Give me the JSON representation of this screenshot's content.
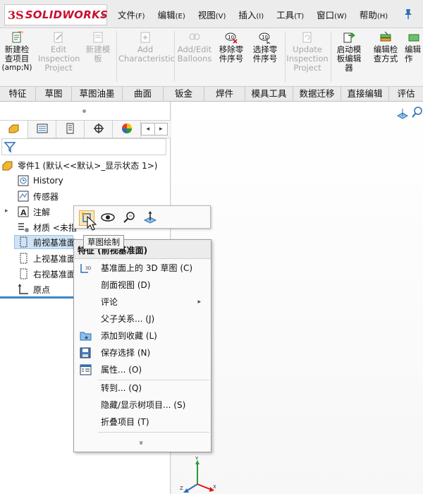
{
  "app": {
    "logo_ds": "3S",
    "logo_word": "SOLIDWORKS"
  },
  "menu": [
    {
      "label": "文件",
      "key": "(F)"
    },
    {
      "label": "编辑",
      "key": "(E)"
    },
    {
      "label": "视图",
      "key": "(V)"
    },
    {
      "label": "插入",
      "key": "(I)"
    },
    {
      "label": "工具",
      "key": "(T)"
    },
    {
      "label": "窗口",
      "key": "(W)"
    },
    {
      "label": "帮助",
      "key": "(H)"
    }
  ],
  "ribbon": {
    "new_inspection": {
      "line1": "新建检",
      "line2": "查项目",
      "line3": "(amp;N)"
    },
    "edit_inspection": {
      "line1": "Edit",
      "line2": "Inspection",
      "line3": "Project"
    },
    "new_template": {
      "line1": "新建模",
      "line2": "板"
    },
    "add_characteristic": {
      "line1": "Add",
      "line2": "Characteristic"
    },
    "add_edit_balloons": {
      "line1": "Add/Edit",
      "line2": "Balloons"
    },
    "remove_seq": {
      "line1": "移除零",
      "line2": "件序号"
    },
    "select_seq": {
      "line1": "选择零",
      "line2": "件序号"
    },
    "update_inspection": {
      "line1": "Update",
      "line2": "Inspection",
      "line3": "Project"
    },
    "launch_template_editor": {
      "line1": "启动模",
      "line2": "板编辑",
      "line3": "器"
    },
    "edit_inspection_method": {
      "line1": "编辑检",
      "line2": "查方式"
    },
    "edit_more": {
      "line1": "编辑",
      "line2": "作"
    }
  },
  "tabs": [
    "特征",
    "草图",
    "草图油墨",
    "曲面",
    "钣金",
    "焊件",
    "模具工具",
    "数据迁移",
    "直接编辑",
    "评估"
  ],
  "tree": {
    "root": "零件1 (默认<<默认>_显示状态 1>)",
    "history": "History",
    "sensors": "传感器",
    "annotations": "注解",
    "material": "材质 <未指",
    "front_plane": "前视基准面",
    "top_plane": "上视基准面",
    "right_plane": "右视基准面",
    "origin": "原点"
  },
  "tooltip": "草图绘制",
  "context_menu": {
    "title": "特征 (前视基准面)",
    "items": [
      {
        "label": "基准面上的 3D 草图 (C)"
      },
      {
        "label": "剖面视图 (D)"
      },
      {
        "label": "评论"
      },
      {
        "label": "父子关系... (J)"
      },
      {
        "label": "添加到收藏 (L)"
      },
      {
        "label": "保存选择 (N)"
      },
      {
        "label": "属性... (O)"
      },
      {
        "label": "转到... (Q)"
      },
      {
        "label": "隐藏/显示树项目... (S)"
      },
      {
        "label": "折叠项目 (T)"
      }
    ],
    "more": "»"
  },
  "triad": {
    "x": "X",
    "y": "Y",
    "z": "Z"
  },
  "colors": {
    "brand": "#c8102e",
    "selection": "#cfe3f7",
    "accent_blue": "#3a86c8"
  }
}
